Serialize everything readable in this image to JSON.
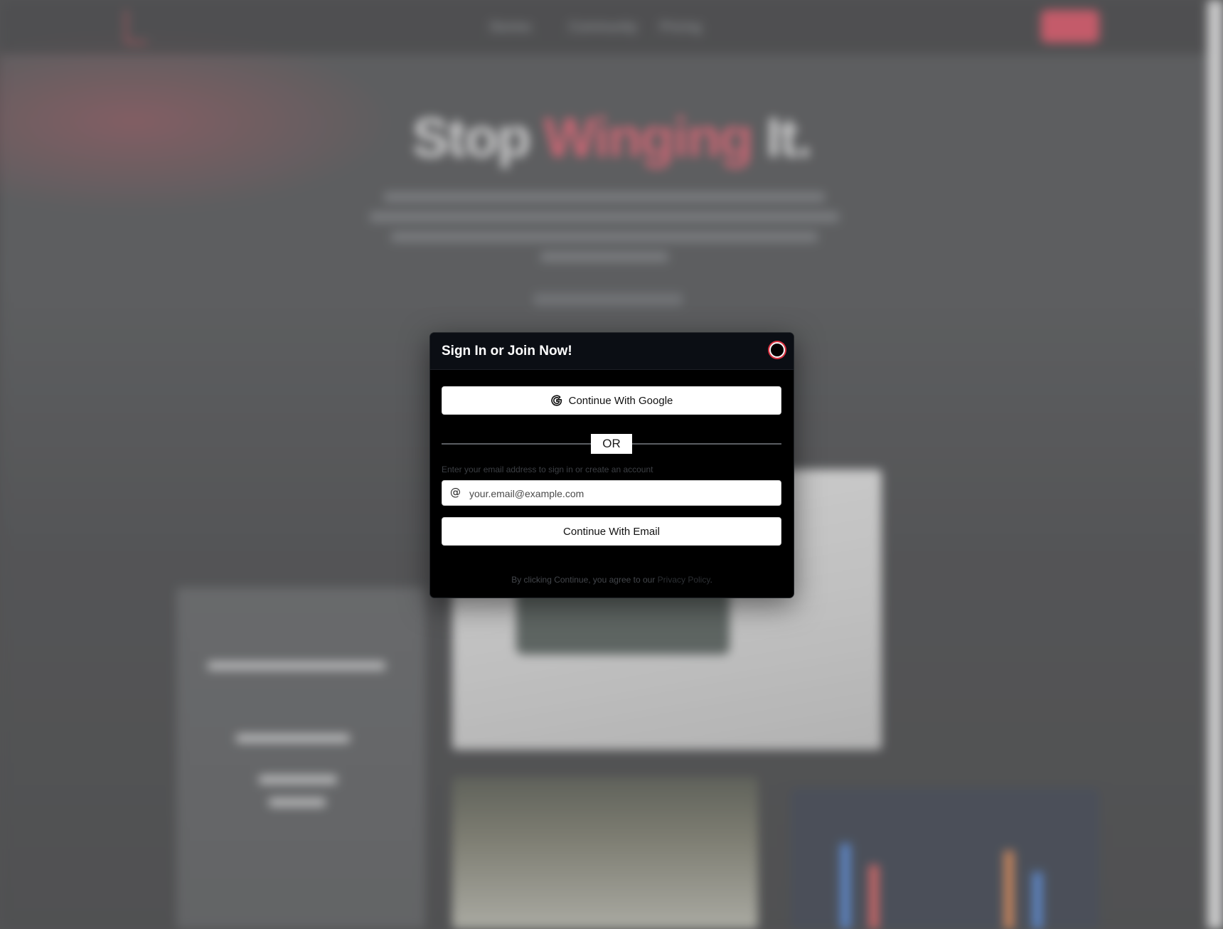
{
  "background": {
    "nav_links": [
      "Stories",
      "Community",
      "Pricing"
    ],
    "nav_button": "Start",
    "hero_title_part1": "Stop",
    "hero_title_accent": "Winging",
    "hero_title_part3": "It.",
    "colors": {
      "accent": "#e84a5f",
      "overlay": "rgba(150,150,150,0.38)"
    }
  },
  "modal": {
    "title": "Sign In or Join Now!",
    "close_icon": "close-circle-icon",
    "google_button_label": "Continue With Google",
    "google_icon": "google-g-icon",
    "divider_text": "OR",
    "email_hint": "Enter your email address to sign in or create an account",
    "email_icon": "at-sign-icon",
    "email_placeholder": "your.email@example.com",
    "email_value": "",
    "email_button_label": "Continue With Email",
    "legal_prefix": "By clicking Continue, you agree to our ",
    "legal_link": "Privacy Policy",
    "legal_suffix": ".",
    "colors": {
      "modal_bg": "#000000",
      "header_bg": "#0b0e14",
      "close_ring": "#d9303f",
      "button_bg": "#ffffff"
    }
  }
}
